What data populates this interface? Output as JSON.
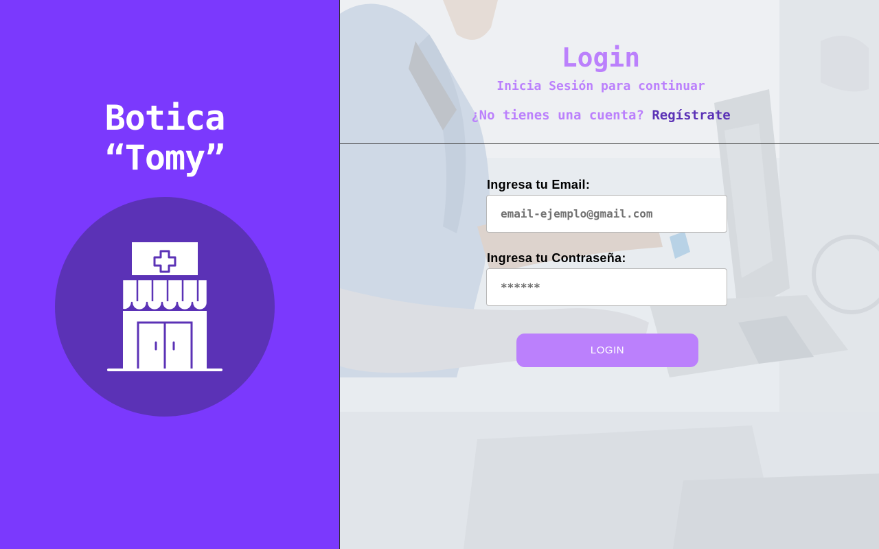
{
  "brand": {
    "title_line1": "Botica",
    "title_line2": "“Tomy”",
    "logo_icon": "pharmacy-store-icon",
    "panel_color": "#7b39fd",
    "circle_color": "#5b32b6"
  },
  "login": {
    "heading": "Login",
    "subtitle": "Inicia Sesión para continuar",
    "register_prompt": "¿No tienes una cuenta?",
    "register_link": "Regístrate",
    "email_label": "Ingresa tu Email:",
    "email_placeholder": "email-ejemplo@gmail.com",
    "password_label": "Ingresa tu Contraseña:",
    "password_placeholder": "******",
    "button_label": "LOGIN",
    "accent_color": "#bb80fc",
    "link_color": "#5b32b6"
  }
}
